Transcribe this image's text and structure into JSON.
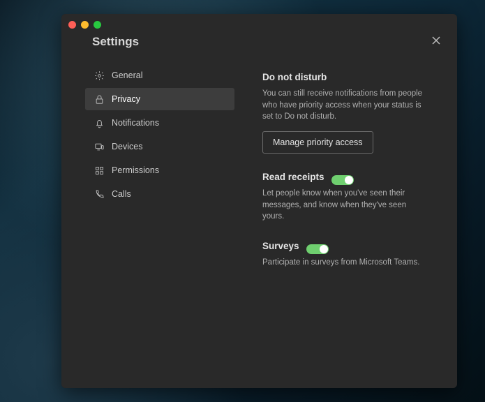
{
  "modal": {
    "title": "Settings",
    "nav": [
      {
        "icon": "gear",
        "label": "General"
      },
      {
        "icon": "lock",
        "label": "Privacy"
      },
      {
        "icon": "bell",
        "label": "Notifications"
      },
      {
        "icon": "devices",
        "label": "Devices"
      },
      {
        "icon": "grid",
        "label": "Permissions"
      },
      {
        "icon": "phone",
        "label": "Calls"
      }
    ],
    "selected_index": 1
  },
  "privacy": {
    "dnd": {
      "title": "Do not disturb",
      "desc": "You can still receive notifications from people who have priority access when your status is set to Do not disturb.",
      "button": "Manage priority access"
    },
    "read_receipts": {
      "title": "Read receipts",
      "desc": "Let people know when you've seen their messages, and know when they've seen yours.",
      "enabled": true
    },
    "surveys": {
      "title": "Surveys",
      "desc": "Participate in surveys from Microsoft Teams.",
      "enabled": true
    }
  },
  "colors": {
    "accent_toggle": "#6fcf6f",
    "window_bg": "#292929"
  }
}
